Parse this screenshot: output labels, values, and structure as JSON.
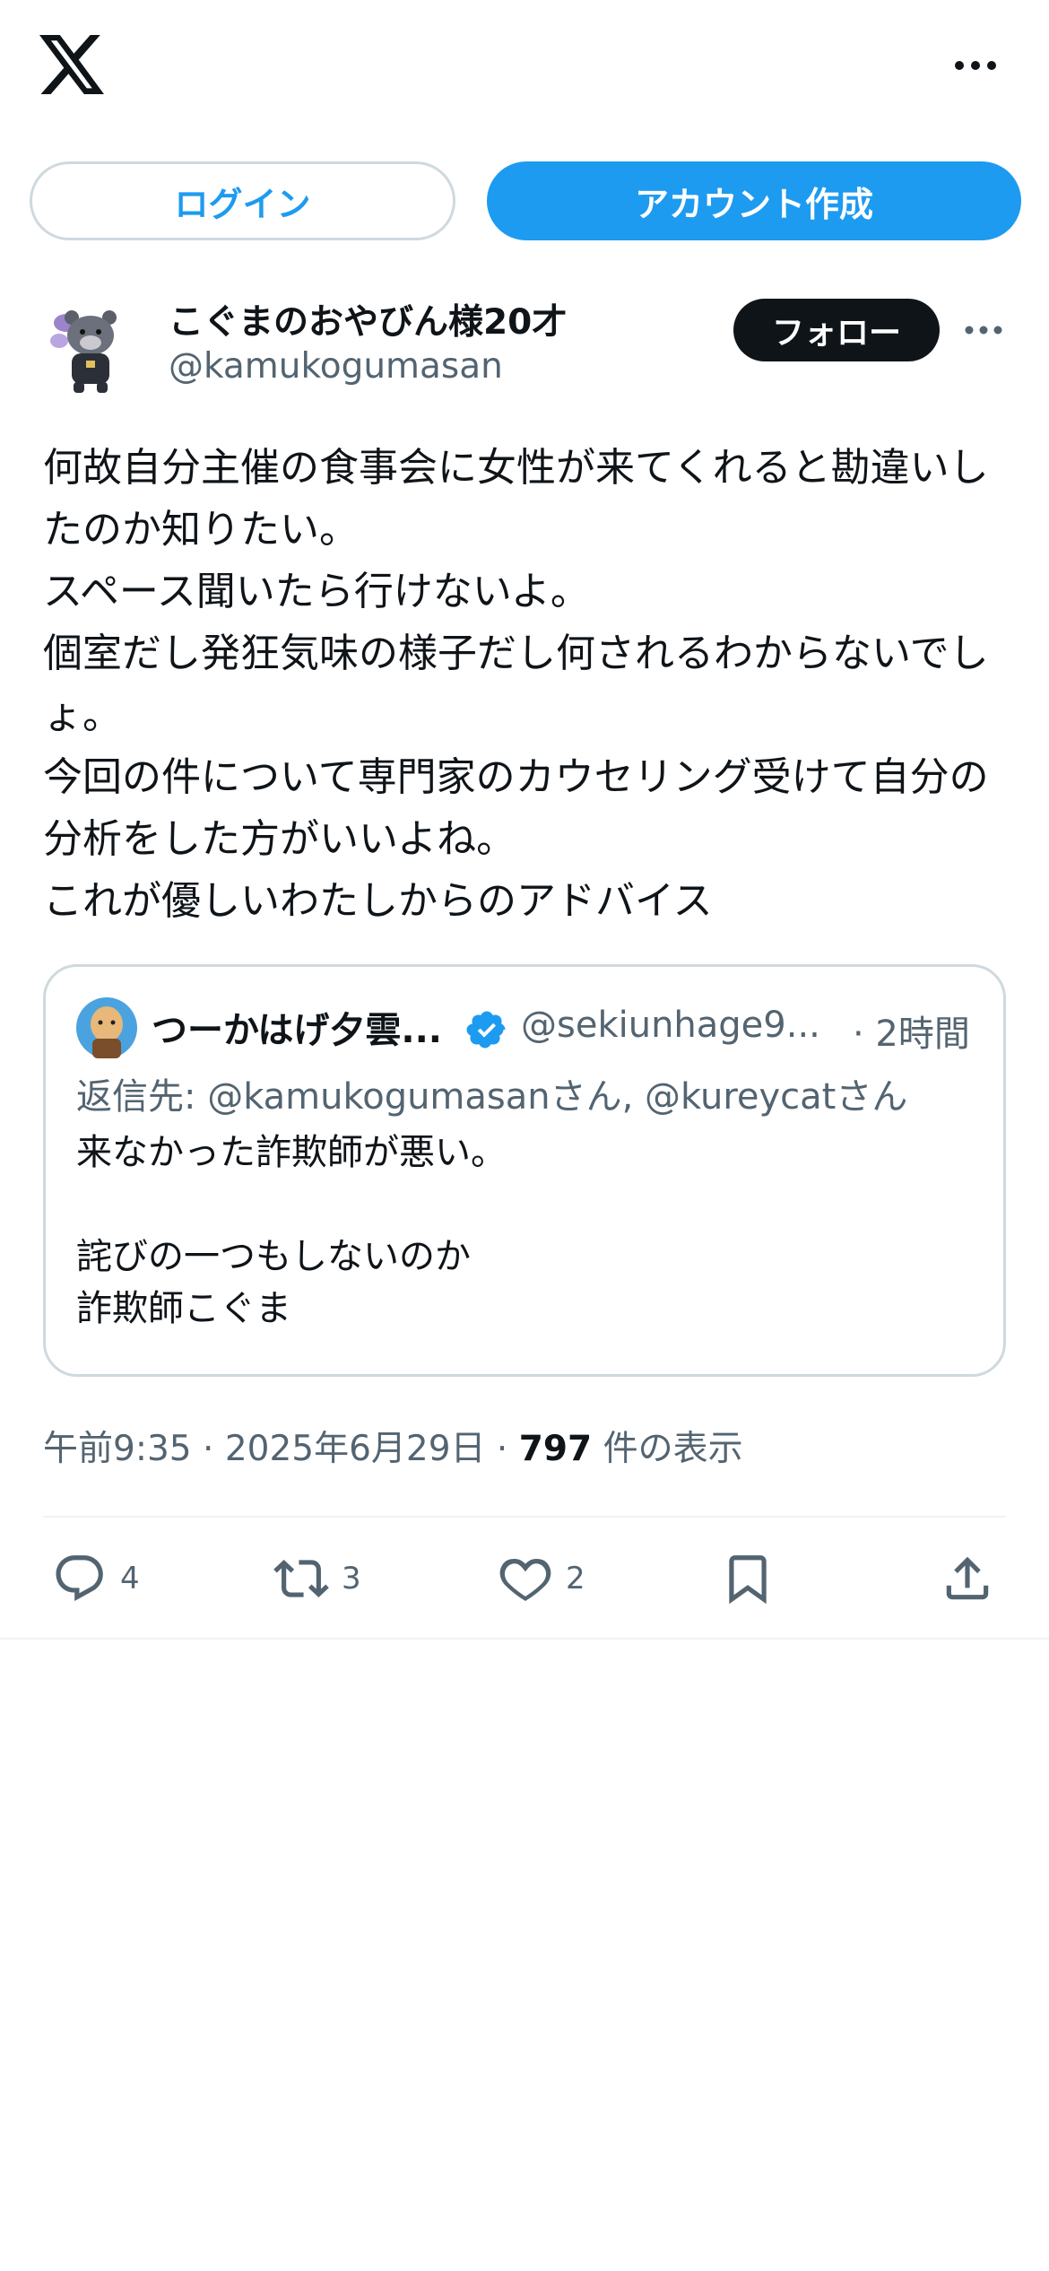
{
  "header": {
    "logo_icon": "x-logo-icon",
    "more_icon": "more-horizontal-icon"
  },
  "auth": {
    "login_label": "ログイン",
    "signup_label": "アカウント作成"
  },
  "post": {
    "author_name": "こぐまのおやびん様20才",
    "author_handle": "@kamukogumasan",
    "follow_label": "フォロー",
    "text": "何故自分主催の食事会に女性が来てくれると勘違いしたのか知りたい。\nスペース聞いたら行けないよ。\n個室だし発狂気味の様子だし何されるわからないでしょ。\n今回の件について専門家のカウセリング受けて自分の分析をした方がいいよね。\nこれが優しいわたしからのアドバイス",
    "time": "午前9:35",
    "sep": "·",
    "date": "2025年6月29日",
    "views_count": "797",
    "views_label": "件の表示"
  },
  "quote": {
    "name": "つーかはげ夕雲...",
    "handle": "@sekiunhage9...",
    "time": "· 2時間",
    "reply_to": "返信先: @kamukogumasanさん, @kureycatさん",
    "text": "来なかった詐欺師が悪い。\n\n詫びの一つもしないのか\n詐欺師こぐま"
  },
  "actions": {
    "reply_count": "4",
    "retweet_count": "3",
    "like_count": "2"
  },
  "colors": {
    "accent": "#1d9bf0",
    "text": "#0f1419",
    "secondary": "#536471",
    "border": "#cfd9de"
  }
}
